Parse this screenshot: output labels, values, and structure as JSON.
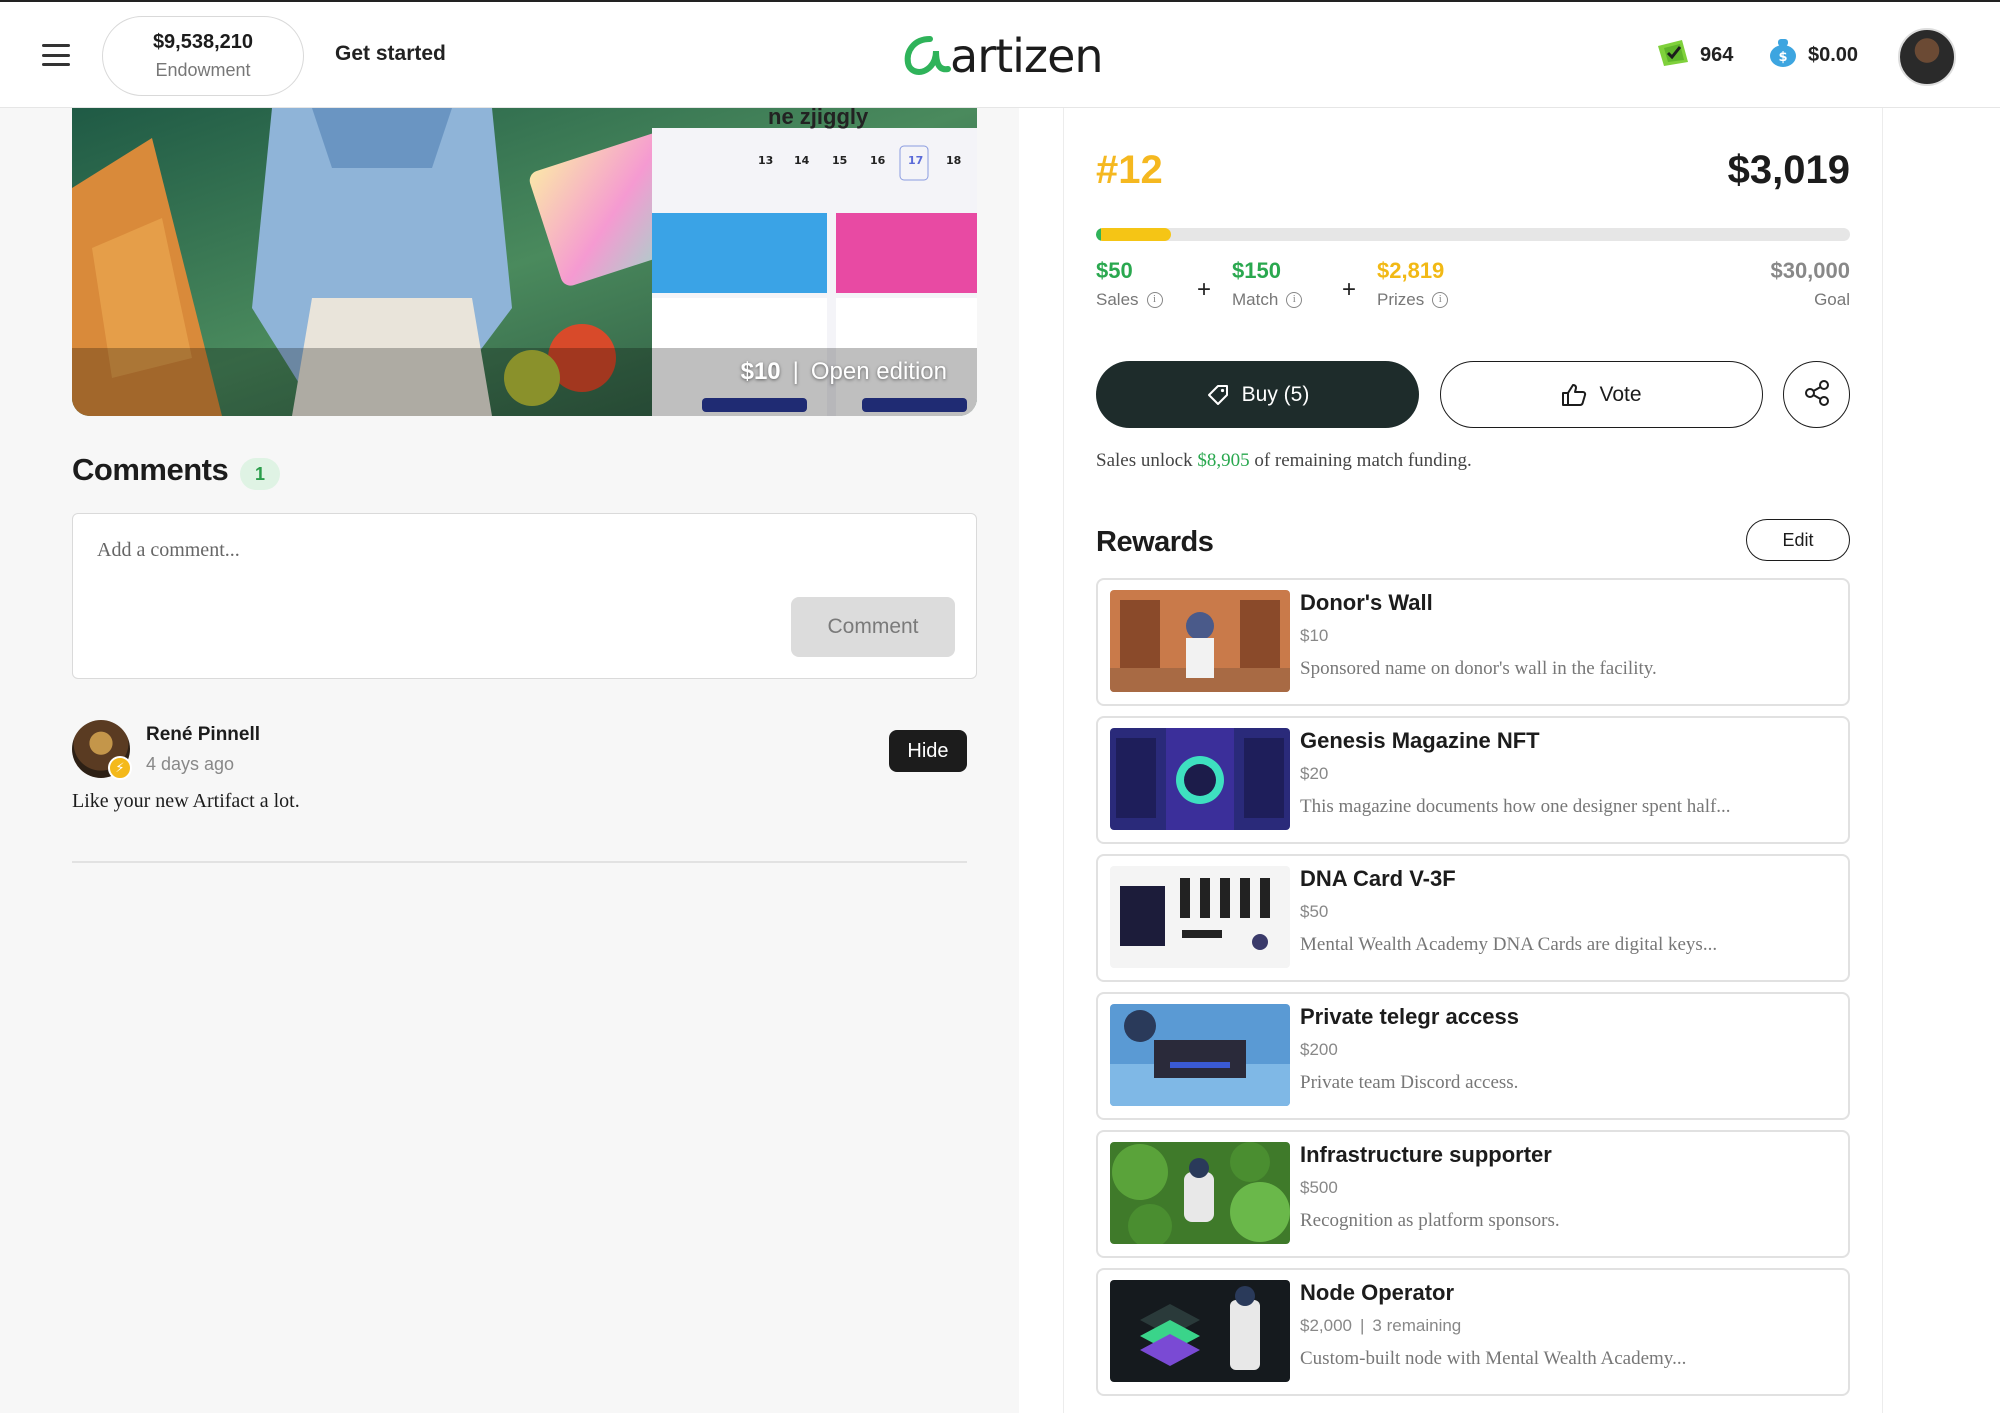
{
  "header": {
    "endowment_amount": "$9,538,210",
    "endowment_label": "Endowment",
    "get_started": "Get started",
    "logo_text": "artizen",
    "votes": "964",
    "balance": "$0.00"
  },
  "hero": {
    "caption": "ne zjiggly",
    "price": "$10",
    "edition": "Open edition"
  },
  "comments": {
    "title": "Comments",
    "count": "1",
    "placeholder": "Add a comment...",
    "submit_label": "Comment",
    "items": [
      {
        "author": "René Pinnell",
        "time": "4 days ago",
        "text": "Like your new Artifact a lot.",
        "hide_label": "Hide"
      }
    ]
  },
  "project": {
    "rank": "#12",
    "total": "$3,019",
    "progress_fraction": 0.1,
    "sales_amount": "$50",
    "sales_label": "Sales",
    "match_amount": "$150",
    "match_label": "Match",
    "prizes_amount": "$2,819",
    "prizes_label": "Prizes",
    "goal_amount": "$30,000",
    "goal_label": "Goal",
    "plus": "+",
    "buy_label": "Buy (5)",
    "vote_label": "Vote",
    "unlock_prefix": "Sales unlock",
    "unlock_amount": "$8,905",
    "unlock_suffix": "of remaining match funding."
  },
  "rewards": {
    "title": "Rewards",
    "edit_label": "Edit",
    "items": [
      {
        "title": "Donor's Wall",
        "price": "$10",
        "remaining": "",
        "desc": "Sponsored name on donor's wall in the facility."
      },
      {
        "title": "Genesis Magazine NFT",
        "price": "$20",
        "remaining": "",
        "desc": "This magazine documents how one designer spent half..."
      },
      {
        "title": "DNA Card V-3F",
        "price": "$50",
        "remaining": "",
        "desc": "Mental Wealth Academy DNA Cards are digital keys..."
      },
      {
        "title": "Private telegr access",
        "price": "$200",
        "remaining": "",
        "desc": "Private team Discord access."
      },
      {
        "title": "Infrastructure supporter",
        "price": "$500",
        "remaining": "",
        "desc": "Recognition as platform sponsors."
      },
      {
        "title": "Node Operator",
        "price": "$2,000",
        "remaining": "3 remaining",
        "desc": "Custom-built node with Mental Wealth Academy..."
      }
    ]
  },
  "colors": {
    "green": "#2aa84f",
    "yellow": "#f5b820",
    "dark": "#1e2c2b"
  }
}
